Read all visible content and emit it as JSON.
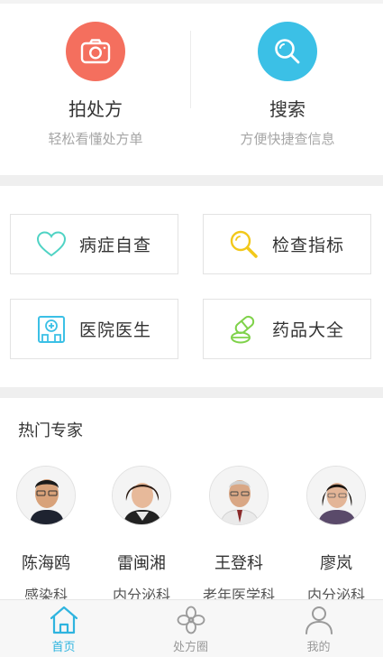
{
  "hero": {
    "photo": {
      "title": "拍处方",
      "subtitle": "轻松看懂处方单",
      "icon": "camera-icon",
      "color": "#f46f5e"
    },
    "search": {
      "title": "搜索",
      "subtitle": "方便快捷查信息",
      "icon": "search-icon",
      "color": "#3bc0e6"
    }
  },
  "features": [
    {
      "label": "病症自查",
      "icon": "heart-icon"
    },
    {
      "label": "检查指标",
      "icon": "magnifier-icon"
    },
    {
      "label": "医院医生",
      "icon": "hospital-icon"
    },
    {
      "label": "药品大全",
      "icon": "pill-icon"
    }
  ],
  "experts": {
    "title": "热门专家",
    "items": [
      {
        "name": "陈海鸥",
        "dept": "感染科"
      },
      {
        "name": "雷闽湘",
        "dept": "内分泌科"
      },
      {
        "name": "王登科",
        "dept": "老年医学科"
      },
      {
        "name": "廖岚",
        "dept": "内分泌科"
      }
    ]
  },
  "tabs": [
    {
      "label": "首页",
      "icon": "home-icon",
      "active": true
    },
    {
      "label": "处方圈",
      "icon": "flower-icon",
      "active": false
    },
    {
      "label": "我的",
      "icon": "user-icon",
      "active": false
    }
  ],
  "colors": {
    "accent": "#2fb4df",
    "icon_teal": "#4fd3c4",
    "icon_yellow": "#f2c81a",
    "icon_green": "#7fd24a"
  }
}
